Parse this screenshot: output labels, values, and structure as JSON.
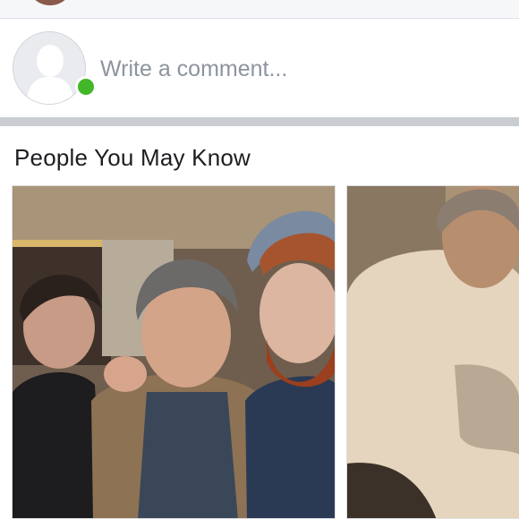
{
  "composer": {
    "placeholder": "Write a comment..."
  },
  "suggestions": {
    "title": "People You May Know",
    "cards": [
      {
        "photo_icon": "group-photo"
      },
      {
        "photo_icon": "person-photo"
      }
    ]
  },
  "colors": {
    "online": "#42b72a",
    "divider": "#c9ccd1",
    "placeholder": "#8d949e",
    "title": "#1c1e21"
  }
}
